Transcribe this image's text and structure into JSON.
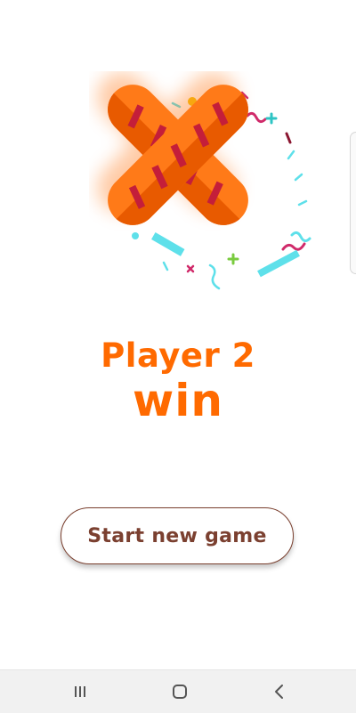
{
  "result": {
    "title": "Player 2",
    "word": "win"
  },
  "actions": {
    "new_game_label": "Start new game"
  },
  "colors": {
    "accent": "#ff6a00",
    "cross_light": "#ff7a18",
    "cross_dark": "#e85a00",
    "cross_stripe": "#c41e3a",
    "button_text": "#7b4030",
    "confetti_cyan": "#5ee0ea",
    "confetti_magenta": "#d02a6a",
    "confetti_green": "#7acb3f",
    "confetti_yellow": "#f5c518",
    "navbar_bg": "#f1f1f1"
  },
  "icons": {
    "winner_mark": "x-mark-icon",
    "nav_recent": "recent-apps-icon",
    "nav_home": "home-icon",
    "nav_back": "back-icon"
  }
}
